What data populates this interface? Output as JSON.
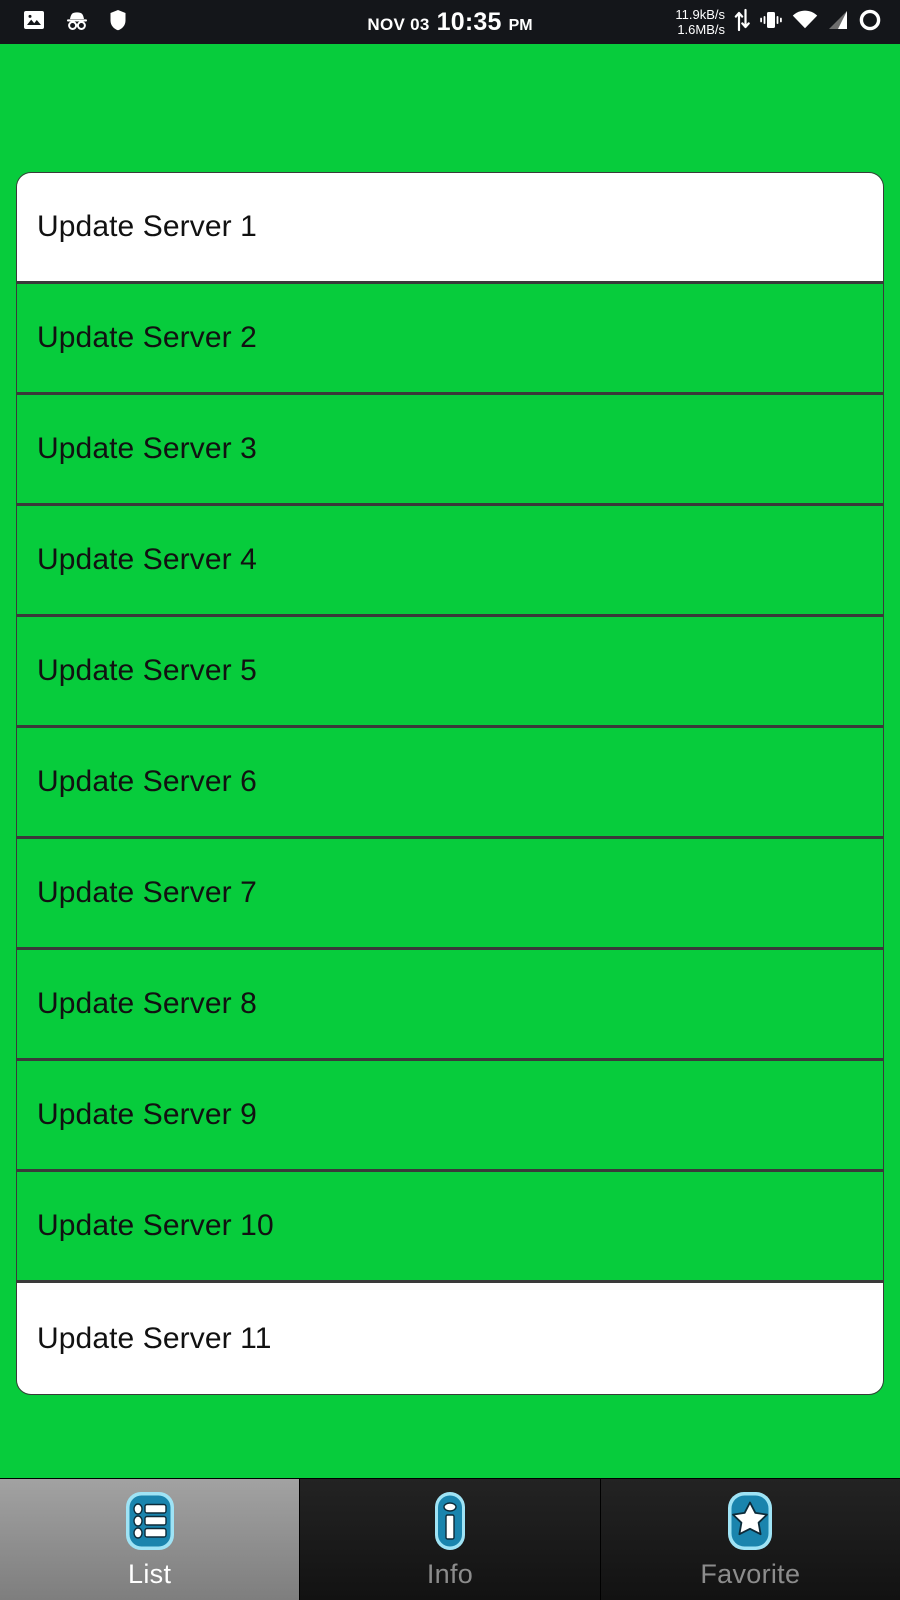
{
  "status_bar": {
    "date": "NOV 03",
    "time": "10:35",
    "ampm": "PM",
    "upload_speed": "11.9kB/s",
    "download_speed": "1.6MB/s",
    "left_icons": [
      "image-icon",
      "incognito-icon",
      "shield-icon"
    ],
    "right_icons": [
      "data-transfer-icon",
      "vibrate-icon",
      "wifi-icon",
      "cellular-signal-icon",
      "battery-icon"
    ],
    "background_color": "#14161a",
    "text_color": "#ffffff"
  },
  "screen": {
    "background_color": "#07cc3c"
  },
  "list": {
    "border_color": "#3a3a3a",
    "selected_background": "#ffffff",
    "row_background": "#07cc3c",
    "items": [
      {
        "label": "Update Server 1",
        "highlighted": true
      },
      {
        "label": "Update Server 2",
        "highlighted": false
      },
      {
        "label": "Update Server 3",
        "highlighted": false
      },
      {
        "label": "Update Server 4",
        "highlighted": false
      },
      {
        "label": "Update Server 5",
        "highlighted": false
      },
      {
        "label": "Update Server 6",
        "highlighted": false
      },
      {
        "label": "Update Server 7",
        "highlighted": false
      },
      {
        "label": "Update Server 8",
        "highlighted": false
      },
      {
        "label": "Update Server 9",
        "highlighted": false
      },
      {
        "label": "Update Server 10",
        "highlighted": false
      },
      {
        "label": "Update Server 11",
        "highlighted": true
      }
    ]
  },
  "bottom_nav": {
    "accent_color": "#1a84ad",
    "selected_index": 0,
    "tabs": [
      {
        "label": "List",
        "icon": "list-icon",
        "selected": true
      },
      {
        "label": "Info",
        "icon": "info-icon",
        "selected": false
      },
      {
        "label": "Favorite",
        "icon": "star-icon",
        "selected": false
      }
    ]
  }
}
